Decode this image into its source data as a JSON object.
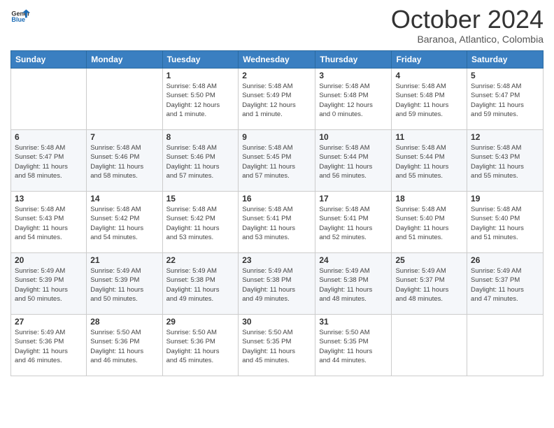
{
  "logo": {
    "line1": "General",
    "line2": "Blue"
  },
  "header": {
    "month": "October 2024",
    "location": "Baranoa, Atlantico, Colombia"
  },
  "weekdays": [
    "Sunday",
    "Monday",
    "Tuesday",
    "Wednesday",
    "Thursday",
    "Friday",
    "Saturday"
  ],
  "weeks": [
    [
      {
        "day": "",
        "info": ""
      },
      {
        "day": "",
        "info": ""
      },
      {
        "day": "1",
        "info": "Sunrise: 5:48 AM\nSunset: 5:50 PM\nDaylight: 12 hours\nand 1 minute."
      },
      {
        "day": "2",
        "info": "Sunrise: 5:48 AM\nSunset: 5:49 PM\nDaylight: 12 hours\nand 1 minute."
      },
      {
        "day": "3",
        "info": "Sunrise: 5:48 AM\nSunset: 5:48 PM\nDaylight: 12 hours\nand 0 minutes."
      },
      {
        "day": "4",
        "info": "Sunrise: 5:48 AM\nSunset: 5:48 PM\nDaylight: 11 hours\nand 59 minutes."
      },
      {
        "day": "5",
        "info": "Sunrise: 5:48 AM\nSunset: 5:47 PM\nDaylight: 11 hours\nand 59 minutes."
      }
    ],
    [
      {
        "day": "6",
        "info": "Sunrise: 5:48 AM\nSunset: 5:47 PM\nDaylight: 11 hours\nand 58 minutes."
      },
      {
        "day": "7",
        "info": "Sunrise: 5:48 AM\nSunset: 5:46 PM\nDaylight: 11 hours\nand 58 minutes."
      },
      {
        "day": "8",
        "info": "Sunrise: 5:48 AM\nSunset: 5:46 PM\nDaylight: 11 hours\nand 57 minutes."
      },
      {
        "day": "9",
        "info": "Sunrise: 5:48 AM\nSunset: 5:45 PM\nDaylight: 11 hours\nand 57 minutes."
      },
      {
        "day": "10",
        "info": "Sunrise: 5:48 AM\nSunset: 5:44 PM\nDaylight: 11 hours\nand 56 minutes."
      },
      {
        "day": "11",
        "info": "Sunrise: 5:48 AM\nSunset: 5:44 PM\nDaylight: 11 hours\nand 55 minutes."
      },
      {
        "day": "12",
        "info": "Sunrise: 5:48 AM\nSunset: 5:43 PM\nDaylight: 11 hours\nand 55 minutes."
      }
    ],
    [
      {
        "day": "13",
        "info": "Sunrise: 5:48 AM\nSunset: 5:43 PM\nDaylight: 11 hours\nand 54 minutes."
      },
      {
        "day": "14",
        "info": "Sunrise: 5:48 AM\nSunset: 5:42 PM\nDaylight: 11 hours\nand 54 minutes."
      },
      {
        "day": "15",
        "info": "Sunrise: 5:48 AM\nSunset: 5:42 PM\nDaylight: 11 hours\nand 53 minutes."
      },
      {
        "day": "16",
        "info": "Sunrise: 5:48 AM\nSunset: 5:41 PM\nDaylight: 11 hours\nand 53 minutes."
      },
      {
        "day": "17",
        "info": "Sunrise: 5:48 AM\nSunset: 5:41 PM\nDaylight: 11 hours\nand 52 minutes."
      },
      {
        "day": "18",
        "info": "Sunrise: 5:48 AM\nSunset: 5:40 PM\nDaylight: 11 hours\nand 51 minutes."
      },
      {
        "day": "19",
        "info": "Sunrise: 5:48 AM\nSunset: 5:40 PM\nDaylight: 11 hours\nand 51 minutes."
      }
    ],
    [
      {
        "day": "20",
        "info": "Sunrise: 5:49 AM\nSunset: 5:39 PM\nDaylight: 11 hours\nand 50 minutes."
      },
      {
        "day": "21",
        "info": "Sunrise: 5:49 AM\nSunset: 5:39 PM\nDaylight: 11 hours\nand 50 minutes."
      },
      {
        "day": "22",
        "info": "Sunrise: 5:49 AM\nSunset: 5:38 PM\nDaylight: 11 hours\nand 49 minutes."
      },
      {
        "day": "23",
        "info": "Sunrise: 5:49 AM\nSunset: 5:38 PM\nDaylight: 11 hours\nand 49 minutes."
      },
      {
        "day": "24",
        "info": "Sunrise: 5:49 AM\nSunset: 5:38 PM\nDaylight: 11 hours\nand 48 minutes."
      },
      {
        "day": "25",
        "info": "Sunrise: 5:49 AM\nSunset: 5:37 PM\nDaylight: 11 hours\nand 48 minutes."
      },
      {
        "day": "26",
        "info": "Sunrise: 5:49 AM\nSunset: 5:37 PM\nDaylight: 11 hours\nand 47 minutes."
      }
    ],
    [
      {
        "day": "27",
        "info": "Sunrise: 5:49 AM\nSunset: 5:36 PM\nDaylight: 11 hours\nand 46 minutes."
      },
      {
        "day": "28",
        "info": "Sunrise: 5:50 AM\nSunset: 5:36 PM\nDaylight: 11 hours\nand 46 minutes."
      },
      {
        "day": "29",
        "info": "Sunrise: 5:50 AM\nSunset: 5:36 PM\nDaylight: 11 hours\nand 45 minutes."
      },
      {
        "day": "30",
        "info": "Sunrise: 5:50 AM\nSunset: 5:35 PM\nDaylight: 11 hours\nand 45 minutes."
      },
      {
        "day": "31",
        "info": "Sunrise: 5:50 AM\nSunset: 5:35 PM\nDaylight: 11 hours\nand 44 minutes."
      },
      {
        "day": "",
        "info": ""
      },
      {
        "day": "",
        "info": ""
      }
    ]
  ]
}
